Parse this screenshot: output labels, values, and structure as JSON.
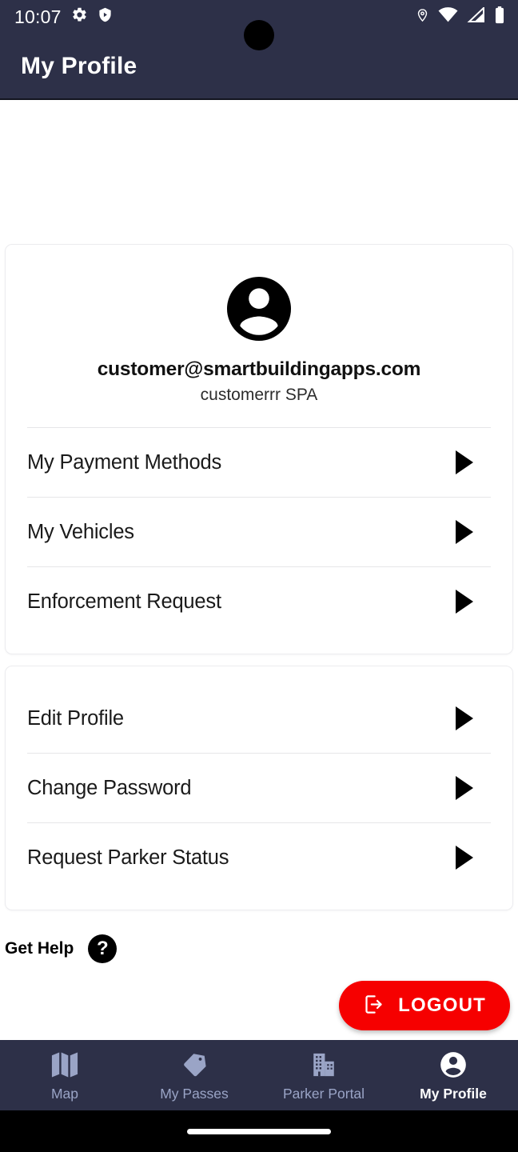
{
  "status_bar": {
    "time": "10:07",
    "left_icons": [
      "gear-icon",
      "shield-play-icon"
    ],
    "right_icons": [
      "location-pin-icon",
      "wifi-icon",
      "cellular-signal-icon",
      "battery-icon"
    ]
  },
  "app_bar": {
    "title": "My Profile",
    "background_color": "#2D3048"
  },
  "profile": {
    "avatar_icon": "account-circle-icon",
    "email": "customer@smartbuildingapps.com",
    "organization": "customerrr SPA"
  },
  "account_menu": {
    "items": [
      {
        "label": "My Payment Methods",
        "chevron": "arrow-right-icon"
      },
      {
        "label": "My Vehicles",
        "chevron": "arrow-right-icon"
      },
      {
        "label": "Enforcement Request",
        "chevron": "arrow-right-icon"
      }
    ]
  },
  "settings_menu": {
    "items": [
      {
        "label": "Edit Profile",
        "chevron": "arrow-right-icon"
      },
      {
        "label": "Change Password",
        "chevron": "arrow-right-icon"
      },
      {
        "label": "Request Parker Status",
        "chevron": "arrow-right-icon"
      }
    ]
  },
  "help": {
    "label": "Get Help",
    "icon": "question-mark-circle-icon",
    "icon_glyph": "?"
  },
  "logout": {
    "label": "LOGOUT",
    "icon": "logout-icon",
    "color": "#F60000",
    "text_color": "#FFFFFF"
  },
  "bottom_nav": {
    "active_index": 3,
    "active_color": "#FFFFFF",
    "inactive_color": "#9AA4C6",
    "items": [
      {
        "label": "Map",
        "icon": "map-icon"
      },
      {
        "label": "My Passes",
        "icon": "tag-icon"
      },
      {
        "label": "Parker Portal",
        "icon": "building-icon"
      },
      {
        "label": "My Profile",
        "icon": "account-circle-icon"
      }
    ]
  }
}
